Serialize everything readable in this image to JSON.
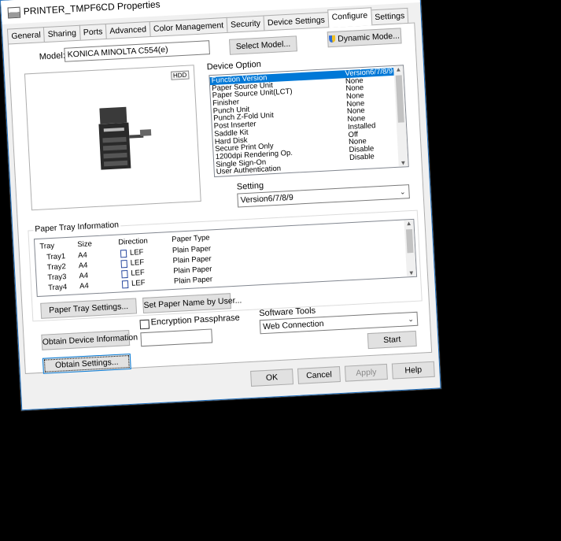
{
  "window": {
    "title": "PRINTER_TMPF6CD Properties",
    "close": "✕"
  },
  "tabs": [
    "General",
    "Sharing",
    "Ports",
    "Advanced",
    "Color Management",
    "Security",
    "Device Settings",
    "Configure",
    "Settings"
  ],
  "active_tab": "Configure",
  "model": {
    "label": "Model:",
    "value": "KONICA MINOLTA C554(e)",
    "select_button": "Select Model...",
    "dynamic_button": "Dynamic Mode..."
  },
  "preview": {
    "badge": "HDD"
  },
  "device_option": {
    "label": "Device Option",
    "items": [
      {
        "name": "Function Version",
        "value": "Version6/7/8/9"
      },
      {
        "name": "Paper Source Unit",
        "value": "None"
      },
      {
        "name": "Paper Source Unit(LCT)",
        "value": "None"
      },
      {
        "name": "Finisher",
        "value": "None"
      },
      {
        "name": "Punch Unit",
        "value": "None"
      },
      {
        "name": "Punch Z-Fold Unit",
        "value": "None"
      },
      {
        "name": "Post Inserter",
        "value": "None"
      },
      {
        "name": "Saddle Kit",
        "value": "Installed"
      },
      {
        "name": "Hard Disk",
        "value": "Off"
      },
      {
        "name": "Secure Print Only",
        "value": "None"
      },
      {
        "name": "1200dpi Rendering Op.",
        "value": "Disable"
      },
      {
        "name": "Single Sign-On",
        "value": "Disable"
      },
      {
        "name": "User Authentication",
        "value": ""
      }
    ],
    "setting_label": "Setting",
    "setting_value": "Version6/7/8/9"
  },
  "paper_tray": {
    "label": "Paper Tray Information",
    "columns": [
      "Tray",
      "Size",
      "Direction",
      "Paper Type"
    ],
    "rows": [
      {
        "tray": "Tray1",
        "size": "A4",
        "direction": "LEF",
        "type": "Plain Paper"
      },
      {
        "tray": "Tray2",
        "size": "A4",
        "direction": "LEF",
        "type": "Plain Paper"
      },
      {
        "tray": "Tray3",
        "size": "A4",
        "direction": "LEF",
        "type": "Plain Paper"
      },
      {
        "tray": "Tray4",
        "size": "A4",
        "direction": "LEF",
        "type": "Plain Paper"
      }
    ],
    "settings_button": "Paper Tray Settings...",
    "set_name_button": "Set Paper Name by User..."
  },
  "actions": {
    "obtain_device_info": "Obtain Device Information",
    "obtain_settings": "Obtain Settings...",
    "encryption_label": "Encryption Passphrase",
    "software_tools_label": "Software Tools",
    "software_tools_value": "Web Connection",
    "start": "Start"
  },
  "footer": {
    "ok": "OK",
    "cancel": "Cancel",
    "apply": "Apply",
    "help": "Help"
  },
  "colors": {
    "accent": "#0078d7",
    "window_bg": "#f0f0f0"
  }
}
